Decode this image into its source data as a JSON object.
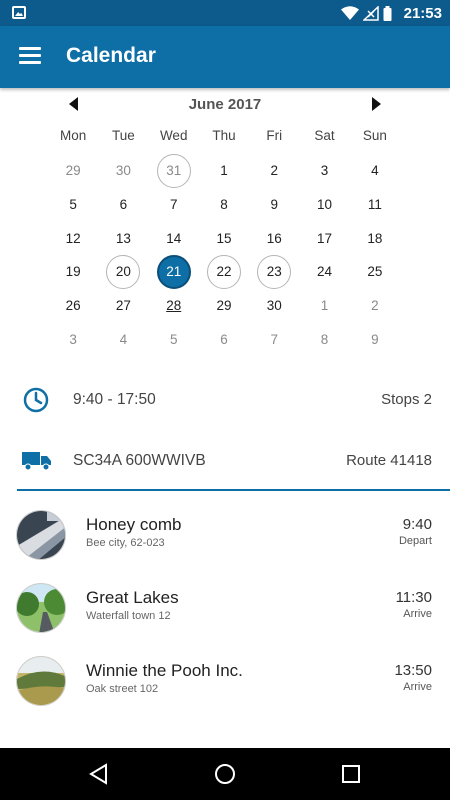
{
  "status": {
    "time": "21:53",
    "icons": [
      "image-icon",
      "wifi-icon",
      "signal-icon",
      "battery-icon"
    ]
  },
  "appbar": {
    "title": "Calendar",
    "menu_icon": "menu-icon"
  },
  "calendar": {
    "month_label": "June 2017",
    "weekdays": [
      "Mon",
      "Tue",
      "Wed",
      "Thu",
      "Fri",
      "Sat",
      "Sun"
    ],
    "days": [
      {
        "d": "29",
        "muted": true
      },
      {
        "d": "30",
        "muted": true
      },
      {
        "d": "31",
        "muted": true,
        "ring": true
      },
      {
        "d": "1"
      },
      {
        "d": "2"
      },
      {
        "d": "3"
      },
      {
        "d": "4"
      },
      {
        "d": "5"
      },
      {
        "d": "6"
      },
      {
        "d": "7"
      },
      {
        "d": "8"
      },
      {
        "d": "9"
      },
      {
        "d": "10"
      },
      {
        "d": "11"
      },
      {
        "d": "12"
      },
      {
        "d": "13"
      },
      {
        "d": "14"
      },
      {
        "d": "15"
      },
      {
        "d": "16"
      },
      {
        "d": "17"
      },
      {
        "d": "18"
      },
      {
        "d": "19"
      },
      {
        "d": "20",
        "ring": true
      },
      {
        "d": "21",
        "selected": true
      },
      {
        "d": "22",
        "ring": true
      },
      {
        "d": "23",
        "ring": true
      },
      {
        "d": "24"
      },
      {
        "d": "25"
      },
      {
        "d": "26"
      },
      {
        "d": "27"
      },
      {
        "d": "28",
        "underline": true
      },
      {
        "d": "29"
      },
      {
        "d": "30"
      },
      {
        "d": "1",
        "muted": true
      },
      {
        "d": "2",
        "muted": true
      },
      {
        "d": "3",
        "muted": true
      },
      {
        "d": "4",
        "muted": true
      },
      {
        "d": "5",
        "muted": true
      },
      {
        "d": "6",
        "muted": true
      },
      {
        "d": "7",
        "muted": true
      },
      {
        "d": "8",
        "muted": true
      },
      {
        "d": "9",
        "muted": true
      }
    ]
  },
  "schedule": {
    "time_range": "9:40 - 17:50",
    "stops": "Stops 2"
  },
  "vehicle": {
    "plate": "SC34A 600WWIVB",
    "route": "Route 41418"
  },
  "stops": [
    {
      "name": "Honey comb",
      "address": "Bee city, 62-023",
      "time": "9:40",
      "kind": "Depart"
    },
    {
      "name": "Great Lakes",
      "address": "Waterfall town 12",
      "time": "11:30",
      "kind": "Arrive"
    },
    {
      "name": "Winnie the Pooh Inc.",
      "address": "Oak street 102",
      "time": "13:50",
      "kind": "Arrive"
    }
  ],
  "colors": {
    "primary": "#0e6fa6",
    "status": "#0d5a8c"
  }
}
